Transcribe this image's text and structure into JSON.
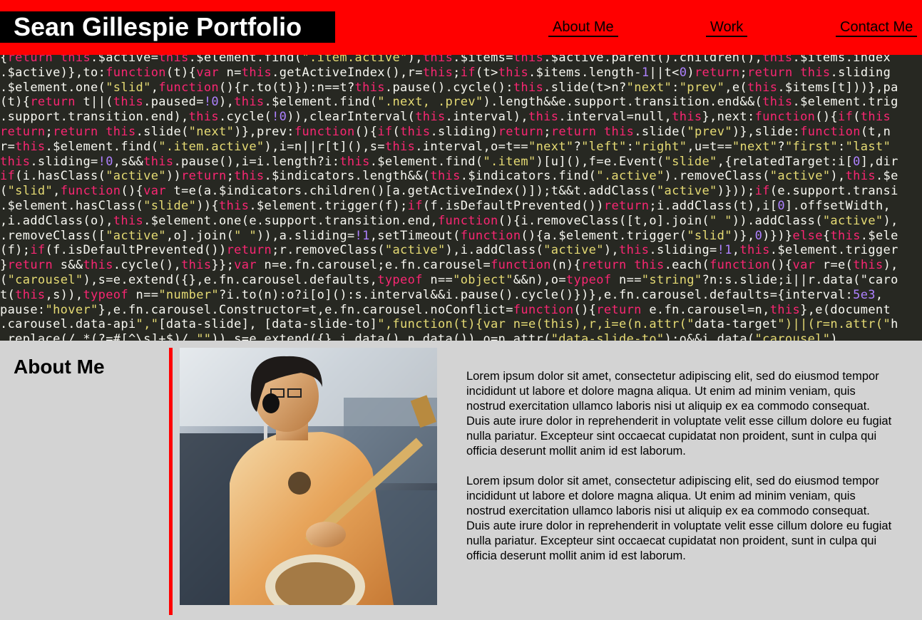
{
  "header": {
    "title": "Sean Gillespie Portfolio",
    "nav": [
      {
        "label": "About Me"
      },
      {
        "label": "Work"
      },
      {
        "label": "Contact Me"
      }
    ]
  },
  "colors": {
    "header_bg": "#ff0000",
    "title_bg": "#000000",
    "title_text": "#ffffff",
    "section_bg": "#d3d3d3",
    "accent": "#ff0000",
    "code_bg": "#272822"
  },
  "hero": {
    "image_desc": "code-screenshot-background",
    "code_lines": [
      "{return this.$active=this.$element.find(\".item.active\"),this.$items=this.$active.parent().children(),this.$items.index",
      ".$active)},to:function(t){var n=this.getActiveIndex(),r=this;if(t>this.$items.length-1||t<0)return;return this.sliding",
      ".$element.one(\"slid\",function(){r.to(t)}):n==t?this.pause().cycle():this.slide(t>n?\"next\":\"prev\",e(this.$items[t]))},pa",
      "(t){return t||(this.paused=!0),this.$element.find(\".next, .prev\").length&&e.support.transition.end&&(this.$element.trig",
      ".support.transition.end),this.cycle(!0)),clearInterval(this.interval),this.interval=null,this},next:function(){if(this",
      "return;return this.slide(\"next\")},prev:function(){if(this.sliding)return;return this.slide(\"prev\")},slide:function(t,n",
      "r=this.$element.find(\".item.active\"),i=n||r[t](),s=this.interval,o=t==\"next\"?\"left\":\"right\",u=t==\"next\"?\"first\":\"last\"",
      "this.sliding=!0,s&&this.pause(),i=i.length?i:this.$element.find(\".item\")[u](),f=e.Event(\"slide\",{relatedTarget:i[0],dir",
      "if(i.hasClass(\"active\"))return;this.$indicators.length&&(this.$indicators.find(\".active\").removeClass(\"active\"),this.$e",
      "(\"slid\",function(){var t=e(a.$indicators.children()[a.getActiveIndex()]);t&&t.addClass(\"active\")}));if(e.support.transi",
      ".$element.hasClass(\"slide\")){this.$element.trigger(f);if(f.isDefaultPrevented())return;i.addClass(t),i[0].offsetWidth,",
      ",i.addClass(o),this.$element.one(e.support.transition.end,function(){i.removeClass([t,o].join(\" \")).addClass(\"active\"),",
      ".removeClass([\"active\",o].join(\" \")),a.sliding=!1,setTimeout(function(){a.$element.trigger(\"slid\")},0)})}else{this.$ele",
      "(f);if(f.isDefaultPrevented())return;r.removeClass(\"active\"),i.addClass(\"active\"),this.sliding=!1,this.$element.trigger",
      "}return s&&this.cycle(),this}};var n=e.fn.carousel;e.fn.carousel=function(n){return this.each(function(){var r=e(this),",
      "(\"carousel\"),s=e.extend({},e.fn.carousel.defaults,typeof n==\"object\"&&n),o=typeof n==\"string\"?n:s.slide;i||r.data(\"caro",
      "t(this,s)),typeof n==\"number\"?i.to(n):o?i[o]():s.interval&&i.pause().cycle()})},e.fn.carousel.defaults={interval:5e3,",
      "pause:\"hover\"},e.fn.carousel.Constructor=t,e.fn.carousel.noConflict=function(){return e.fn.carousel=n,this},e(document",
      ".carousel.data-api\",\"[data-slide], [data-slide-to]\",function(t){var n=e(this),r,i=e(n.attr(\"data-target\")||(r=n.attr(\"h",
      ".replace(/.*(?=#[^\\s]+$)/,\"\")),s=e.extend({},i.data(),n.data()),o=n.attr(\"data-slide-to\");o&&i.data(\"carousel\")"
    ]
  },
  "about": {
    "heading": "About Me",
    "photo_desc": "musician-with-bass-guitar-photo",
    "paragraphs": [
      "Lorem ipsum dolor sit amet, consectetur adipiscing elit, sed do eiusmod tempor incididunt ut labore et dolore magna aliqua. Ut enim ad minim veniam, quis nostrud exercitation ullamco laboris nisi ut aliquip ex ea commodo consequat. Duis aute irure dolor in reprehenderit in voluptate velit esse cillum dolore eu fugiat nulla pariatur. Excepteur sint occaecat cupidatat non proident, sunt in culpa qui officia deserunt mollit anim id est laborum.",
      "Lorem ipsum dolor sit amet, consectetur adipiscing elit, sed do eiusmod tempor incididunt ut labore et dolore magna aliqua. Ut enim ad minim veniam, quis nostrud exercitation ullamco laboris nisi ut aliquip ex ea commodo consequat. Duis aute irure dolor in reprehenderit in voluptate velit esse cillum dolore eu fugiat nulla pariatur. Excepteur sint occaecat cupidatat non proident, sunt in culpa qui officia deserunt mollit anim id est laborum."
    ]
  }
}
